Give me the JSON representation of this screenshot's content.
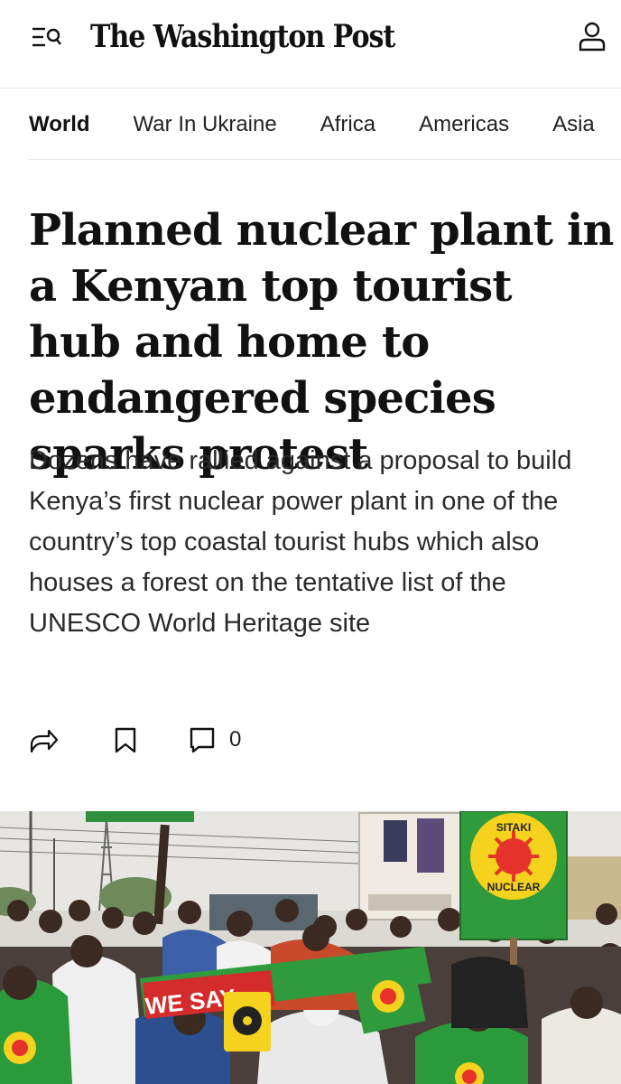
{
  "header": {
    "logo_text": "The Washington Post",
    "menu_icon": "menu-search-icon",
    "account_icon": "user-account-icon"
  },
  "nav": {
    "items": [
      {
        "label": "World",
        "active": true
      },
      {
        "label": "War In Ukraine",
        "active": false
      },
      {
        "label": "Africa",
        "active": false
      },
      {
        "label": "Americas",
        "active": false
      },
      {
        "label": "Asia",
        "active": false
      }
    ]
  },
  "article": {
    "headline": "Planned nuclear plant in a Kenyan top tourist hub and home to endangered species sparks protest",
    "dek": "Dozens have rallied against a proposal to build Kenya’s first nuclear power plant in one of the country’s top coastal tourist hubs which also houses a forest on the tentative list of the UNESCO World Heritage site",
    "comment_count": "0",
    "share_icon": "share-icon",
    "bookmark_icon": "bookmark-icon",
    "comment_icon": "comment-icon"
  },
  "photo": {
    "sign_top": "SITAKI",
    "sign_bottom": "NUCLEAR",
    "banner_text": "WE SAY"
  },
  "colors": {
    "text": "#111111",
    "rule": "#e4e4e4",
    "sign_green": "#2f9b3c",
    "sign_yellow": "#f4d21d",
    "sun_red": "#e5322a",
    "banner_red": "#d42b2b"
  }
}
